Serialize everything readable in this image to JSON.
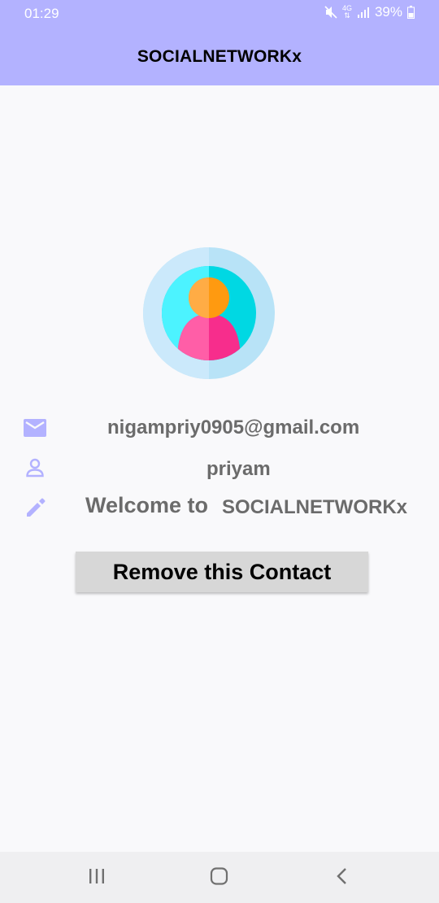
{
  "status_bar": {
    "time": "01:29",
    "network": "4G",
    "battery": "39%",
    "icons": [
      "mute-icon",
      "network-icon",
      "signal-icon",
      "battery-icon"
    ]
  },
  "app_bar": {
    "title": "SOCIALNETWORKx",
    "color": "#b3b2ff"
  },
  "profile": {
    "avatar_icon": "user-avatar-icon",
    "email": "nigampriy0905@gmail.com",
    "name": "priyam",
    "status_prefix": "Welcome to",
    "status_app": "SOCIALNETWORKx",
    "icon_color": "#b3b2ff"
  },
  "actions": {
    "remove_label": "Remove this Contact"
  },
  "nav_bar": {
    "icons": [
      "recent-apps-icon",
      "home-icon",
      "back-icon"
    ]
  }
}
